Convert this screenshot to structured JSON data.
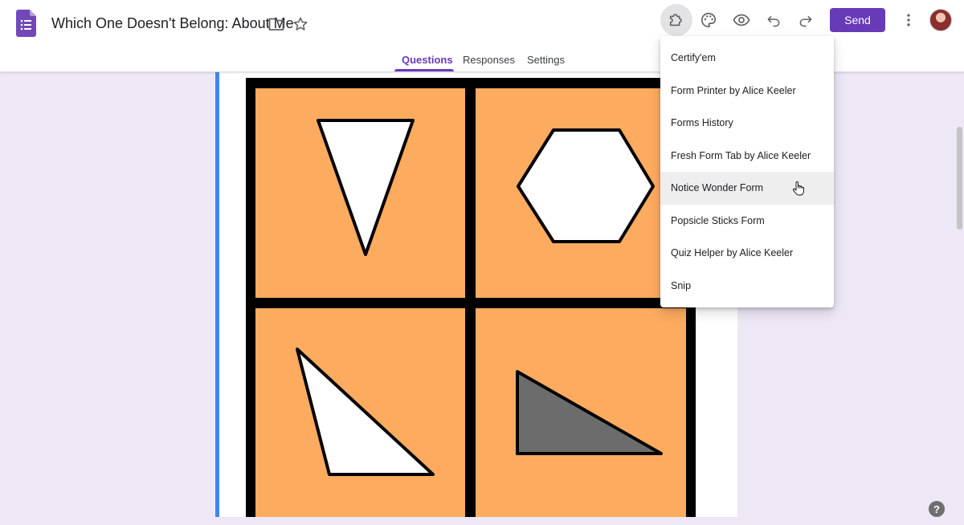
{
  "header": {
    "title": "Which One Doesn't Belong: About Me",
    "send_label": "Send",
    "icons": [
      "google-forms-logo",
      "folder-icon",
      "star-icon",
      "add-ons-puzzle-icon",
      "palette-icon",
      "eye-icon",
      "undo-icon",
      "redo-icon",
      "more-vert-icon"
    ]
  },
  "tabs": [
    {
      "label": "Questions",
      "active": true
    },
    {
      "label": "Responses",
      "active": false
    },
    {
      "label": "Settings",
      "active": false
    }
  ],
  "addon_menu": {
    "items": [
      {
        "label": "Certify'em"
      },
      {
        "label": "Form Printer by Alice Keeler"
      },
      {
        "label": "Forms History"
      },
      {
        "label": "Fresh Form Tab by Alice Keeler"
      },
      {
        "label": "Notice Wonder Form",
        "hovered": true
      },
      {
        "label": "Popsicle Sticks Form"
      },
      {
        "label": "Quiz Helper by Alice Keeler"
      },
      {
        "label": "Snip"
      }
    ]
  },
  "help": {
    "label": "?"
  },
  "colors": {
    "accent": "#673ab7",
    "card_accent": "#4285f4",
    "background": "#ede7f6",
    "image_orange": "#fdab5f",
    "shape_gray": "#6c6c6c"
  }
}
